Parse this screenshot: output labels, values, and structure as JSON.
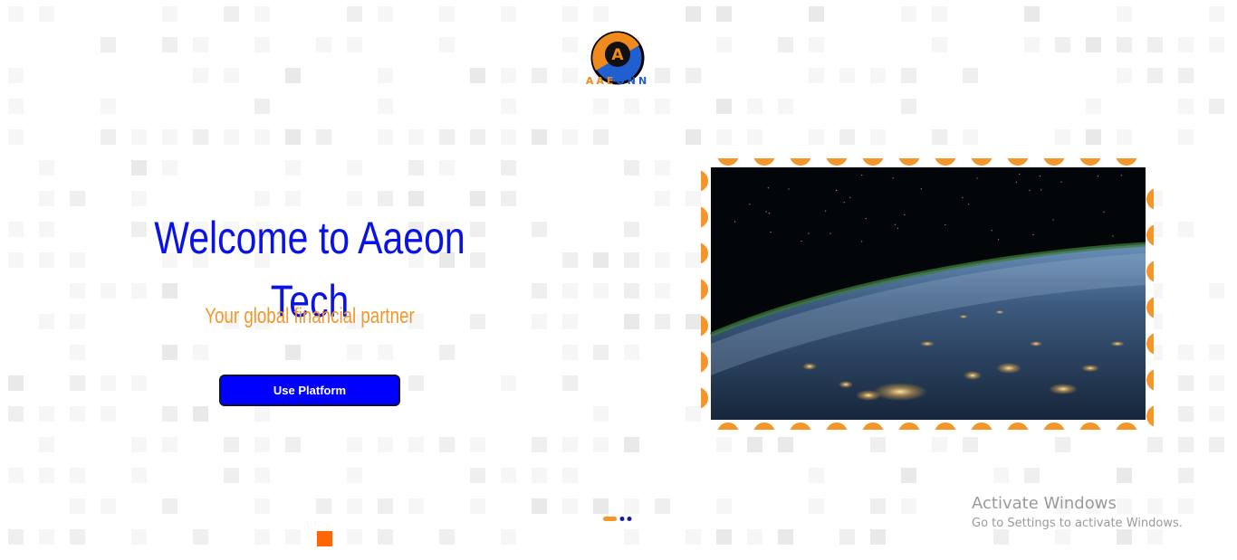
{
  "brand": {
    "logo_letter": "A",
    "wordmark_part1": "AAE",
    "wordmark_part2": "ONN"
  },
  "hero": {
    "title": "Welcome to Aaeon Tech",
    "subtitle": "Your global financial partner",
    "cta_label": "Use Platform"
  },
  "carousel": {
    "active_index": 0,
    "slide_count": 3
  },
  "watermark": {
    "title": "Activate Windows",
    "subtitle": "Go to Settings to activate Windows."
  },
  "colors": {
    "accent_blue": "#0a12e6",
    "accent_orange": "#f5962a",
    "button_bg": "#0000ff",
    "square_orange": "#ff6600"
  },
  "icons": {
    "logo": "aaeonn-logo-icon",
    "hero_image": "earth-at-night-image"
  }
}
